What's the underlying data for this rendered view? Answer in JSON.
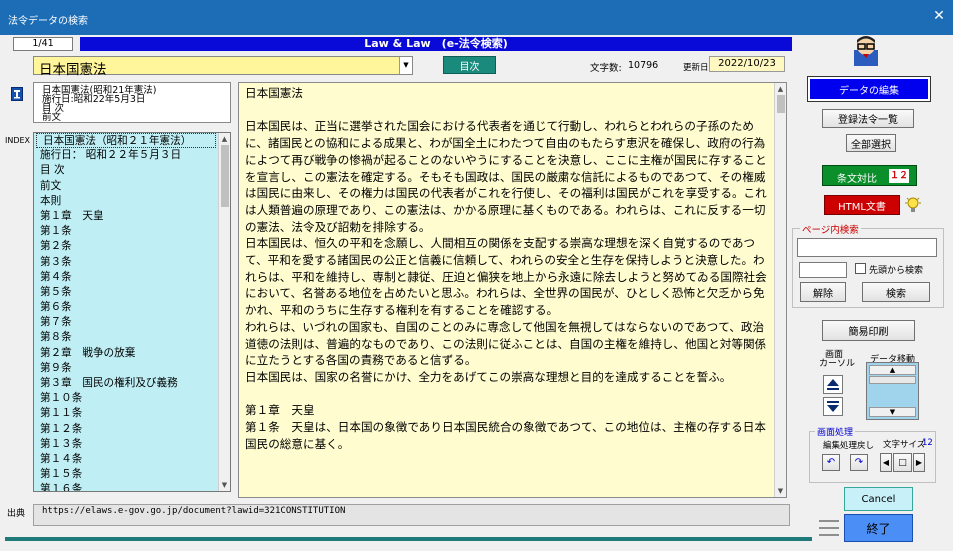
{
  "window": {
    "title": "法令データの検索"
  },
  "toolbar": {
    "page_indicator": "1/41",
    "banner": "Law & Law　(e-法令検索)",
    "law_select_value": "日本国憲法",
    "toc_button": "目次",
    "char_count_label": "文字数:",
    "char_count_value": "10796",
    "updated_label": "更新日",
    "updated_value": "2022/10/23"
  },
  "info_lines": [
    "日本国憲法(昭和21年憲法)",
    "施行日:昭和22年5月3日",
    "目 次",
    "前文"
  ],
  "index": {
    "label": "INDEX",
    "items": [
      "日本国憲法（昭和２１年憲法）",
      "施行日： 昭和２２年５月３日",
      "目 次",
      "前文",
      "本則",
      "第１章　天皇",
      "第１条",
      "第２条",
      "第３条",
      "第４条",
      "第５条",
      "第６条",
      "第７条",
      "第８条",
      "第２章　戦争の放棄",
      "第９条",
      "第３章　国民の権利及び義務",
      "第１０条",
      "第１１条",
      "第１２条",
      "第１３条",
      "第１４条",
      "第１５条",
      "第１６条"
    ]
  },
  "content": {
    "text": "日本国憲法\n\n日本国民は、正当に選挙された国会における代表者を通じて行動し、われらとわれらの子孫のために、諸国民との協和による成果と、わが国全土にわたつて自由のもたらす恵沢を確保し、政府の行為によつて再び戦争の惨禍が起ることのないやうにすることを決意し、ここに主権が国民に存することを宣言し、この憲法を確定する。そもそも国政は、国民の厳粛な信託によるものであつて、その権威は国民に由来し、その権力は国民の代表者がこれを行使し、その福利は国民がこれを享受する。これは人類普遍の原理であり、この憲法は、かかる原理に基くものである。われらは、これに反する一切の憲法、法令及び詔勅を排除する。\n日本国民は、恒久の平和を念願し、人間相互の関係を支配する崇高な理想を深く自覚するのであつて、平和を愛する諸国民の公正と信義に信頼して、われらの安全と生存を保持しようと決意した。われらは、平和を維持し、専制と隷従、圧迫と偏狭を地上から永遠に除去しようと努めてゐる国際社会において、名誉ある地位を占めたいと思ふ。われらは、全世界の国民が、ひとしく恐怖と欠乏から免かれ、平和のうちに生存する権利を有することを確認する。\nわれらは、いづれの国家も、自国のことのみに専念して他国を無視してはならないのであつて、政治道徳の法則は、普遍的なものであり、この法則に従ふことは、自国の主権を維持し、他国と対等関係に立たうとする各国の責務であると信ずる。\n日本国民は、国家の名誉にかけ、全力をあげてこの崇高な理想と目的を達成することを誓ふ。\n\n第１章　天皇\n第１条　天皇は、日本国の象徴であり日本国民統合の象徴であつて、この地位は、主権の存する日本国民の総意に基く。"
  },
  "source": {
    "label": "出典",
    "url": "https://elaws.e-gov.go.jp/document?lawid=321CONSTITUTION"
  },
  "right": {
    "edit_data": "データの編集",
    "registered_list": "登録法令一覧",
    "select_all": "全部選択",
    "compare": "条文対比",
    "compare_badge": "１２",
    "html_doc": "HTML文書",
    "page_search_label": "ページ内検索",
    "search_from_top": "先頭から検索",
    "clear": "解除",
    "search": "検索",
    "simple_print": "簡易印刷",
    "screen_cursor_label": "画面\nカーソル",
    "data_move_label": "データ移動",
    "screen_proc_label": "画面処理",
    "edit_undo_label": "編集処理戻し",
    "font_size_label": "文字サイズ",
    "font_size_value": "12",
    "cancel": "Cancel",
    "finish": "終了"
  },
  "colors": {
    "titlebar": "#1c6db5",
    "banner": "#0a0ad8",
    "law_field": "#fff59a",
    "content_bg": "#fffdd0",
    "index_bg": "#bfeff5",
    "edit_btn": "#0000ee",
    "compare_btn": "#0a8f2a",
    "html_btn": "#cc0000",
    "finish_btn": "#4b8ef5",
    "cancel_btn": "#c8f0f8"
  }
}
